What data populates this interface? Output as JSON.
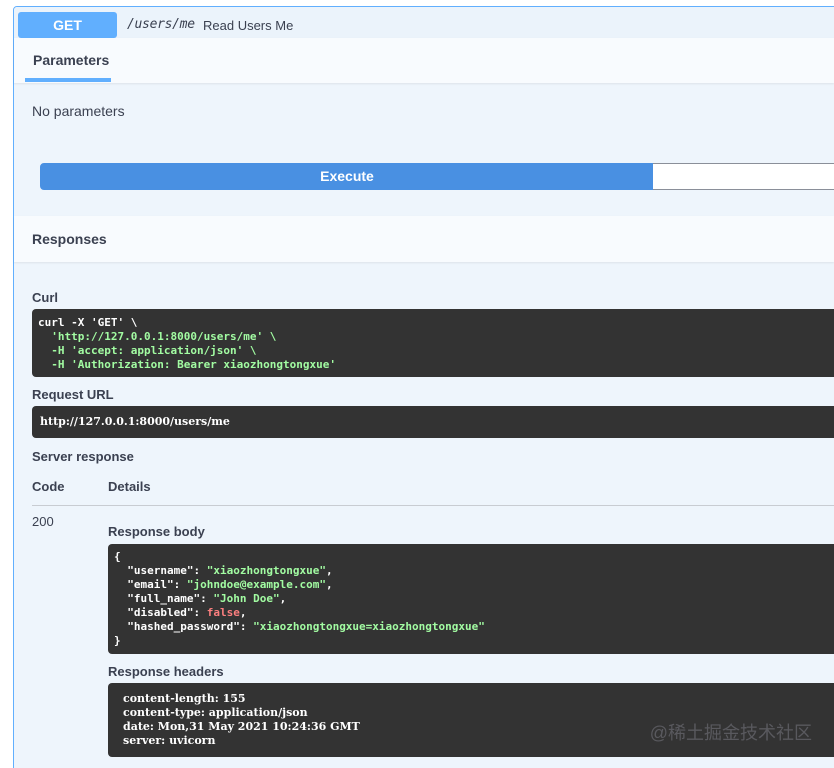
{
  "operation": {
    "method": "GET",
    "path": "/users/me",
    "summary": "Read Users Me"
  },
  "parameters": {
    "tab_label": "Parameters",
    "empty_text": "No parameters"
  },
  "execute_label": "Execute",
  "responses": {
    "title": "Responses",
    "curl_label": "Curl",
    "curl_lines": [
      "curl -X 'GET' \\",
      "  'http://127.0.0.1:8000/users/me' \\",
      "  -H 'accept: application/json' \\",
      "  -H 'Authorization: Bearer xiaozhongtongxue'"
    ],
    "request_url_label": "Request URL",
    "request_url": "http://127.0.0.1:8000/users/me",
    "server_response_label": "Server response",
    "col_code": "Code",
    "col_details": "Details",
    "status_code": "200",
    "body_label": "Response body",
    "body": {
      "username": "xiaozhongtongxue",
      "email": "johndoe@example.com",
      "full_name": "John Doe",
      "disabled": "false",
      "hashed_password": "xiaozhongtongxue=xiaozhongtongxue"
    },
    "headers_label": "Response headers",
    "headers": [
      "content-length: 155",
      "content-type: application/json",
      "date: Mon,31 May 2021 10:24:36 GMT",
      "server: uvicorn"
    ]
  },
  "watermark": "@稀土掘金技术社区",
  "colors": {
    "get_method": "#61affe",
    "execute": "#4990e2",
    "code_bg": "#333333",
    "string": "#a2fca2",
    "boolean": "#fc7f7f"
  }
}
